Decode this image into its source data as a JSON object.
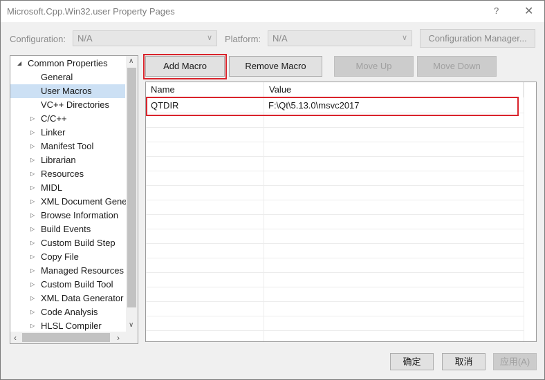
{
  "window": {
    "title": "Microsoft.Cpp.Win32.user Property Pages",
    "help": "?",
    "close": "✕"
  },
  "config": {
    "configuration_label": "Configuration:",
    "configuration_value": "N/A",
    "platform_label": "Platform:",
    "platform_value": "N/A",
    "manager_button": "Configuration Manager..."
  },
  "tree": {
    "items": [
      {
        "label": "Common Properties",
        "expander": "◢"
      },
      {
        "label": "General",
        "expander": ""
      },
      {
        "label": "User Macros",
        "expander": ""
      },
      {
        "label": "VC++ Directories",
        "expander": ""
      },
      {
        "label": "C/C++",
        "expander": "▷"
      },
      {
        "label": "Linker",
        "expander": "▷"
      },
      {
        "label": "Manifest Tool",
        "expander": "▷"
      },
      {
        "label": "Librarian",
        "expander": "▷"
      },
      {
        "label": "Resources",
        "expander": "▷"
      },
      {
        "label": "MIDL",
        "expander": "▷"
      },
      {
        "label": "XML Document Gene",
        "expander": "▷"
      },
      {
        "label": "Browse Information",
        "expander": "▷"
      },
      {
        "label": "Build Events",
        "expander": "▷"
      },
      {
        "label": "Custom Build Step",
        "expander": "▷"
      },
      {
        "label": "Copy File",
        "expander": "▷"
      },
      {
        "label": "Managed Resources",
        "expander": "▷"
      },
      {
        "label": "Custom Build Tool",
        "expander": "▷"
      },
      {
        "label": "XML Data Generator",
        "expander": "▷"
      },
      {
        "label": "Code Analysis",
        "expander": "▷"
      },
      {
        "label": "HLSL Compiler",
        "expander": "▷"
      }
    ],
    "selected": "User Macros"
  },
  "toolbar": {
    "add_macro": "Add Macro",
    "remove_macro": "Remove Macro",
    "move_up": "Move Up",
    "move_down": "Move Down"
  },
  "macros": {
    "columns": [
      "Name",
      "Value"
    ],
    "rows": [
      {
        "name": "QTDIR",
        "value": "F:\\Qt\\5.13.0\\msvc2017"
      }
    ]
  },
  "footer": {
    "ok": "确定",
    "cancel": "取消",
    "apply": "应用(A)"
  },
  "colors": {
    "highlight_box": "#d9232b",
    "selected_tree_bg": "#cce0f4"
  }
}
